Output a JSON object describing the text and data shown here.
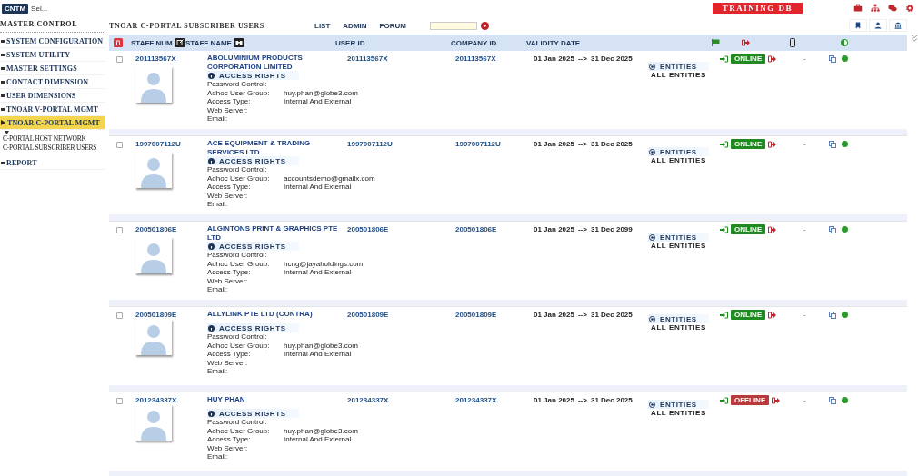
{
  "app_badge": "CNTM",
  "app_label": "Sel...",
  "environment": "TRAINING DB",
  "sidebar": {
    "title": "MASTER CONTROL",
    "items": [
      {
        "label": "SYSTEM CONFIGURATION",
        "selected": false
      },
      {
        "label": "SYSTEM UTILITY",
        "selected": false
      },
      {
        "label": "MASTER SETTINGS",
        "selected": false
      },
      {
        "label": "CONTACT DIMENSION",
        "selected": false
      },
      {
        "label": "USER DIMENSIONS",
        "selected": false
      },
      {
        "label": "TNOAR V-PORTAL MGMT",
        "selected": false
      },
      {
        "label": "TNOAR C-PORTAL MGMT",
        "selected": true,
        "children": [
          {
            "label": "C-PORTAL HOST NETWORK"
          },
          {
            "label": "C-PORTAL SUBSCRIBER USERS"
          }
        ]
      },
      {
        "label": "REPORT",
        "selected": false
      }
    ]
  },
  "page_title": "TNOAR C-PORTAL SUBSCRIBER USERS",
  "nav": [
    "LIST",
    "ADMIN",
    "FORUM"
  ],
  "table": {
    "columns": [
      "STAFF NUM",
      "STAFF NAME",
      "USER ID",
      "COMPANY ID",
      "VALIDITY DATE"
    ],
    "rows": [
      {
        "checked": false,
        "staff_num": "201113567X",
        "name": "ABOLUMINIUM PRODUCTS CORPORATION LIMITED",
        "user_id": "201113567X",
        "company_id": "201113567X",
        "from": "01 Jan 2025",
        "arrow": "-->",
        "to": "31 Dec 2025",
        "access_title": "ACCESS RIGHTS",
        "fields": [
          {
            "label": "Password Control:"
          },
          {
            "label": "Adhoc User Group:",
            "value": "huy.phan@globe3.com"
          },
          {
            "label": "Access Type:",
            "value": "Internal And External"
          },
          {
            "label": "Web Server:"
          },
          {
            "label": "Email:"
          }
        ],
        "entities_title": "ENTITIES",
        "entities": "ALL ENTITIES",
        "status": "ONLINE",
        "online": true,
        "dash": "-"
      },
      {
        "checked": false,
        "staff_num": "1997007112U",
        "name": "ACE EQUIPMENT & TRADING SERVICES LTD",
        "user_id": "1997007112U",
        "company_id": "1997007112U",
        "from": "01 Jan 2025",
        "arrow": "-->",
        "to": "31 Dec 2025",
        "access_title": "ACCESS RIGHTS",
        "fields": [
          {
            "label": "Password Control:"
          },
          {
            "label": "Adhoc User Group:",
            "value": "accountsdemo@gmailx.com"
          },
          {
            "label": "Access Type:",
            "value": "Internal And External"
          },
          {
            "label": "Web Server:"
          },
          {
            "label": "Email:"
          }
        ],
        "entities_title": "ENTITIES",
        "entities": "ALL ENTITIES",
        "status": "ONLINE",
        "online": true,
        "dash": "-"
      },
      {
        "checked": false,
        "staff_num": "200501806E",
        "name": "ALGINTONS PRINT & GRAPHICS PTE LTD",
        "user_id": "200501806E",
        "company_id": "200501806E",
        "from": "01 Jan 2025",
        "arrow": "-->",
        "to": "31 Dec 2099",
        "access_title": "ACCESS RIGHTS",
        "fields": [
          {
            "label": "Password Control:"
          },
          {
            "label": "Adhoc User Group:",
            "value": "hcng@jayaholdings.com"
          },
          {
            "label": "Access Type:",
            "value": "Internal And External"
          },
          {
            "label": "Web Server:"
          },
          {
            "label": "Email:"
          }
        ],
        "entities_title": "ENTITIES",
        "entities": "ALL ENTITIES",
        "status": "ONLINE",
        "online": true,
        "dash": "-"
      },
      {
        "checked": false,
        "staff_num": "200501809E",
        "name": "ALLYLINK PTE LTD (CONTRA)",
        "user_id": "200501809E",
        "company_id": "200501809E",
        "from": "01 Jan 2025",
        "arrow": "-->",
        "to": "31 Dec 2025",
        "access_title": "ACCESS RIGHTS",
        "fields": [
          {
            "label": "Password Control:"
          },
          {
            "label": "Adhoc User Group:",
            "value": "huy.phan@globe3.com"
          },
          {
            "label": "Access Type:",
            "value": "Internal And External"
          },
          {
            "label": "Web Server:"
          },
          {
            "label": "Email:"
          }
        ],
        "entities_title": "ENTITIES",
        "entities": "ALL ENTITIES",
        "status": "ONLINE",
        "online": true,
        "dash": "-"
      },
      {
        "checked": false,
        "staff_num": "201234337X",
        "name": "HUY PHAN",
        "user_id": "201234337X",
        "company_id": "201234337X",
        "from": "01 Jan 2025",
        "arrow": "-->",
        "to": "31 Dec 2025",
        "access_title": "ACCESS RIGHTS",
        "fields": [
          {
            "label": "Password Control:"
          },
          {
            "label": "Adhoc User Group:",
            "value": "huy.phan@globe3.com"
          },
          {
            "label": "Access Type:",
            "value": "Internal And External"
          },
          {
            "label": "Web Server:"
          },
          {
            "label": "Email:"
          }
        ],
        "entities_title": "ENTITIES",
        "entities": "ALL ENTITIES",
        "status": "OFFLINE",
        "online": false,
        "dash": "-"
      }
    ]
  }
}
